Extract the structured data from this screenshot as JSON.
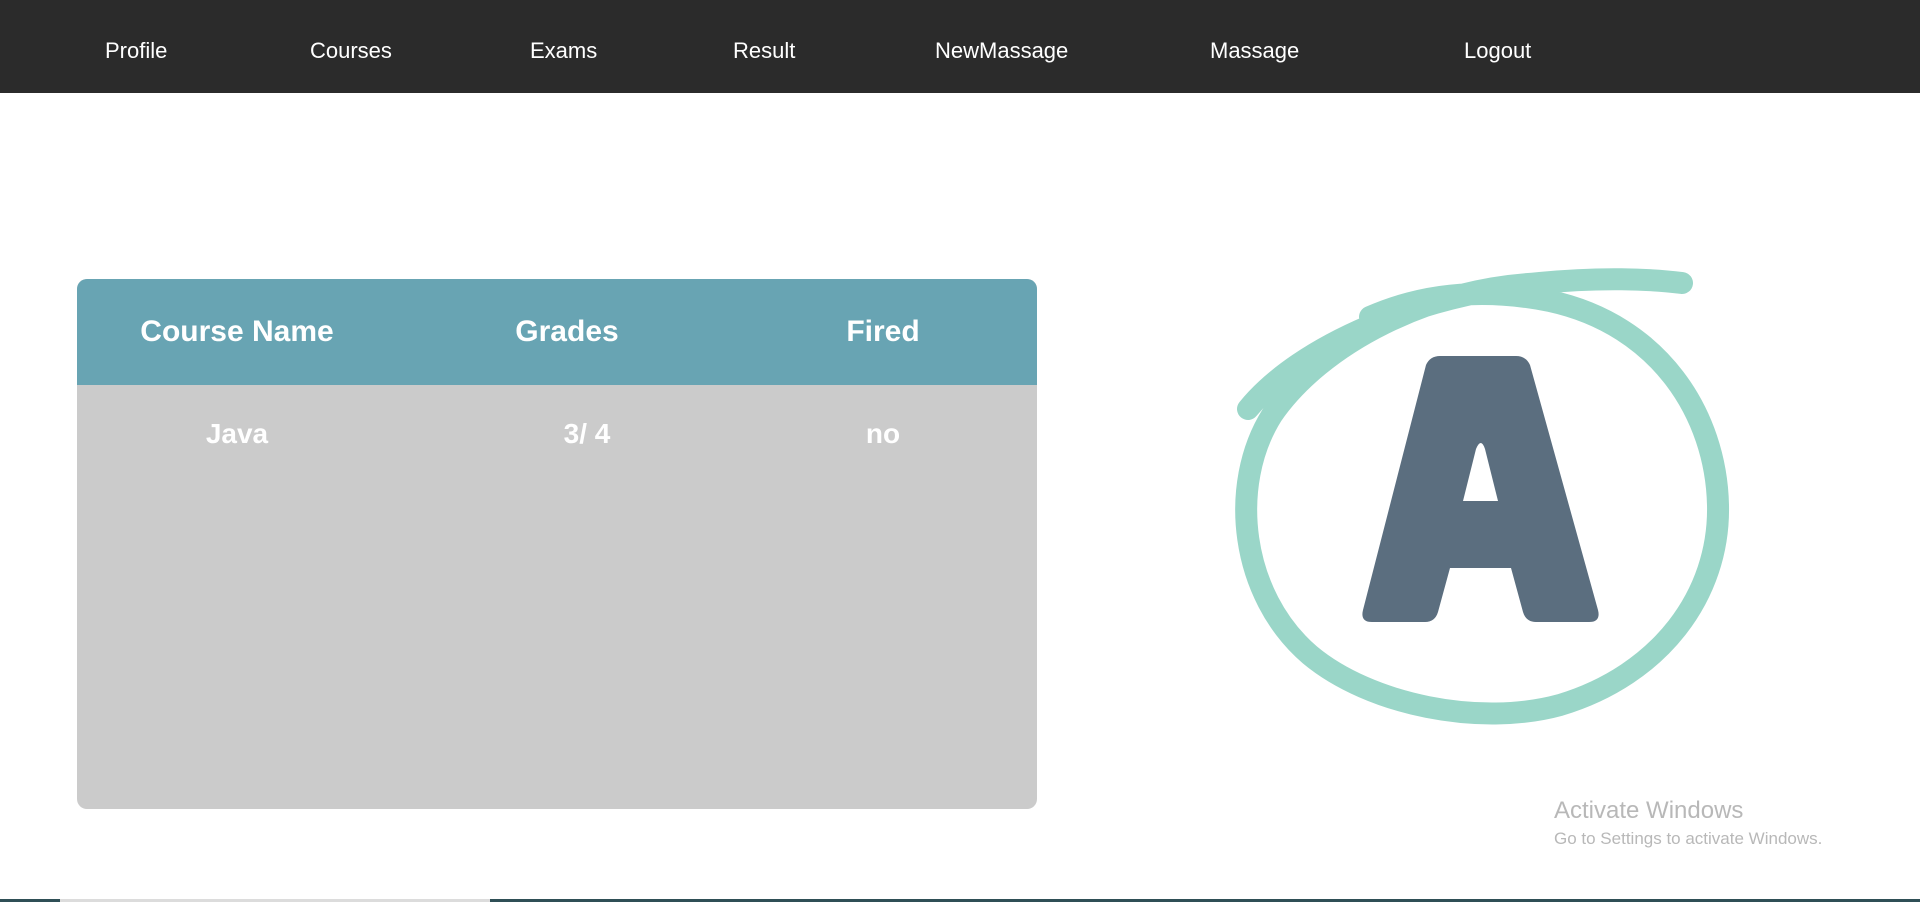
{
  "nav": {
    "items": [
      {
        "label": "Profile"
      },
      {
        "label": "Courses"
      },
      {
        "label": "Exams"
      },
      {
        "label": "Result"
      },
      {
        "label": "NewMassage"
      },
      {
        "label": "Massage"
      },
      {
        "label": "Logout"
      }
    ]
  },
  "results_table": {
    "headers": [
      "Course Name",
      "Grades",
      "Fired"
    ],
    "rows": [
      {
        "course": "Java",
        "grade": "3/ 4",
        "fired": "no"
      }
    ]
  },
  "logo": {
    "letter": "A",
    "letter_color": "#5b6e7f",
    "circle_color": "#9ad6c8"
  },
  "watermark": {
    "title": "Activate Windows",
    "subtitle": "Go to Settings to activate Windows."
  },
  "colors": {
    "navbar_bg": "#2b2b2b",
    "table_header_bg": "#68a4b3",
    "table_body_bg": "#cbcbcb"
  }
}
